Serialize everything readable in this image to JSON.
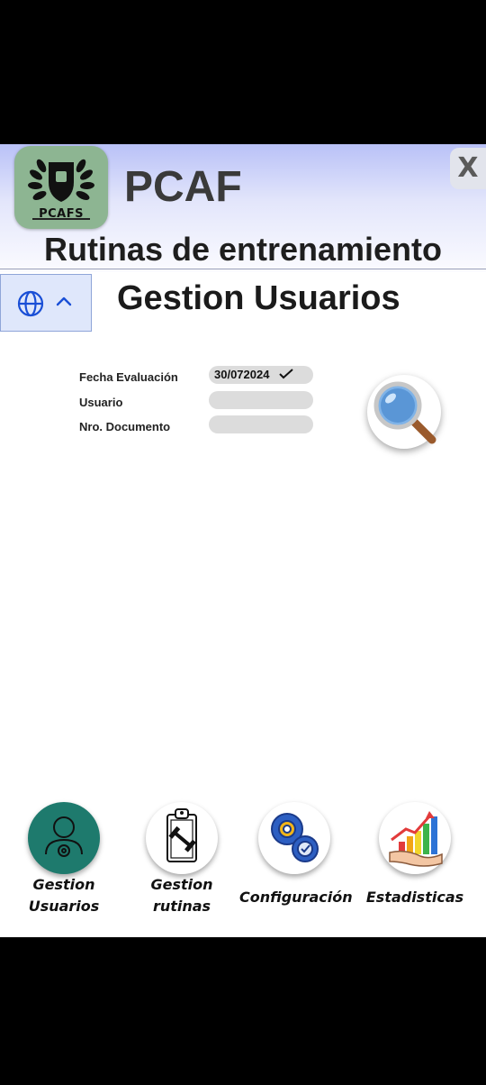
{
  "header": {
    "logo_text": "PCAFS",
    "brand": "PCAF",
    "close_label": "X",
    "app_title": "Rutinas de entrenamiento"
  },
  "language": {
    "icon": "globe-icon",
    "toggle_icon": "chevron-up-icon"
  },
  "page": {
    "title": "Gestion Usuarios"
  },
  "form": {
    "fields": [
      {
        "label": "Fecha  Evaluación",
        "value": "30/072024"
      },
      {
        "label": "Usuario",
        "value": ""
      },
      {
        "label": "Nro. Documento",
        "value": ""
      }
    ],
    "search_icon": "magnifier-icon"
  },
  "nav": [
    {
      "label_line1": "Gestion",
      "label_line2": "Usuarios",
      "icon": "user-gear-icon",
      "color": "#1e7a6d"
    },
    {
      "label_line1": "Gestion",
      "label_line2": "rutinas",
      "icon": "clipboard-dumbbell-icon"
    },
    {
      "label_line1": "Configuración",
      "icon": "gears-icon"
    },
    {
      "label_line1": "Estadisticas",
      "icon": "growth-chart-icon"
    }
  ]
}
